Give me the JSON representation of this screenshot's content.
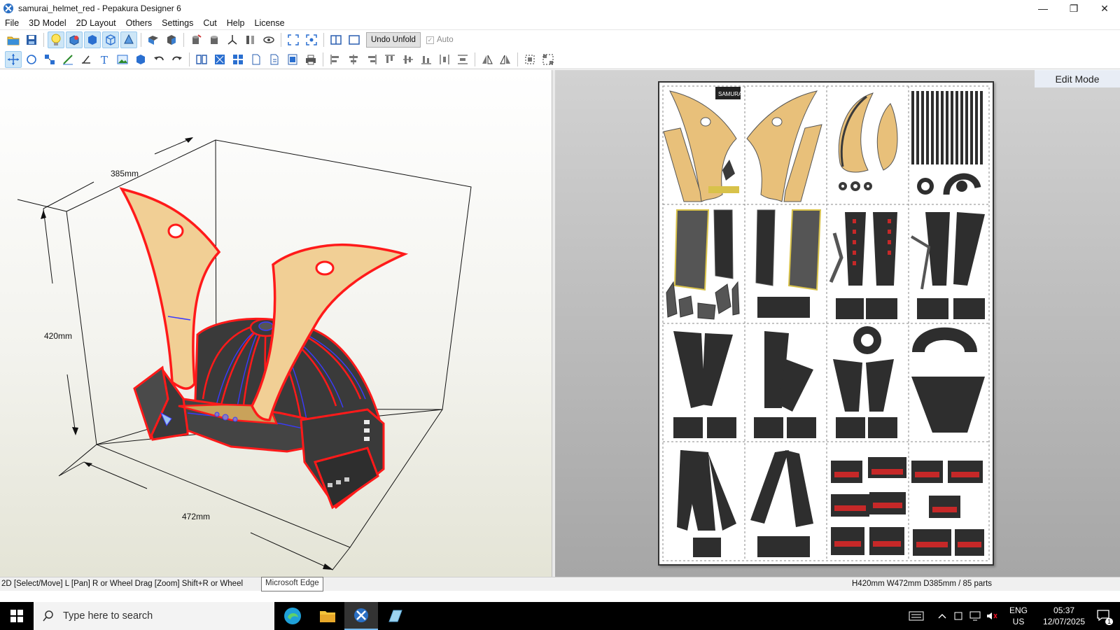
{
  "window": {
    "title": "samurai_helmet_red - Pepakura Designer 6",
    "controls": {
      "minimize": "—",
      "maximize": "❐",
      "close": "✕"
    }
  },
  "menu": [
    "File",
    "3D Model",
    "2D Layout",
    "Others",
    "Settings",
    "Cut",
    "Help",
    "License"
  ],
  "toolbar": {
    "undo_unfold_label": "Undo Unfold",
    "auto_label": "Auto",
    "auto_checked": "✓"
  },
  "view3d": {
    "dim_width": "385mm",
    "dim_height": "420mm",
    "dim_depth": "472mm"
  },
  "view2d": {
    "edit_mode_label": "Edit Mode",
    "logo_text": "SAMURAI"
  },
  "status": {
    "left": "2D [Select/Move] L [Pan] R or Wheel Drag [Zoom] Shift+R or Wheel",
    "right": "H420mm W472mm D385mm / 85 parts",
    "tooltip": "Microsoft Edge"
  },
  "taskbar": {
    "search_placeholder": "Type here to search",
    "lang_top": "ENG",
    "lang_bottom": "US",
    "time": "05:37",
    "date": "12/07/2025",
    "notification_count": "1"
  },
  "colors": {
    "tan": "#E8C07A",
    "dark_part": "#3a3a3a",
    "red_edge": "#ff1a1a",
    "blue_edge": "#3a3aff"
  }
}
